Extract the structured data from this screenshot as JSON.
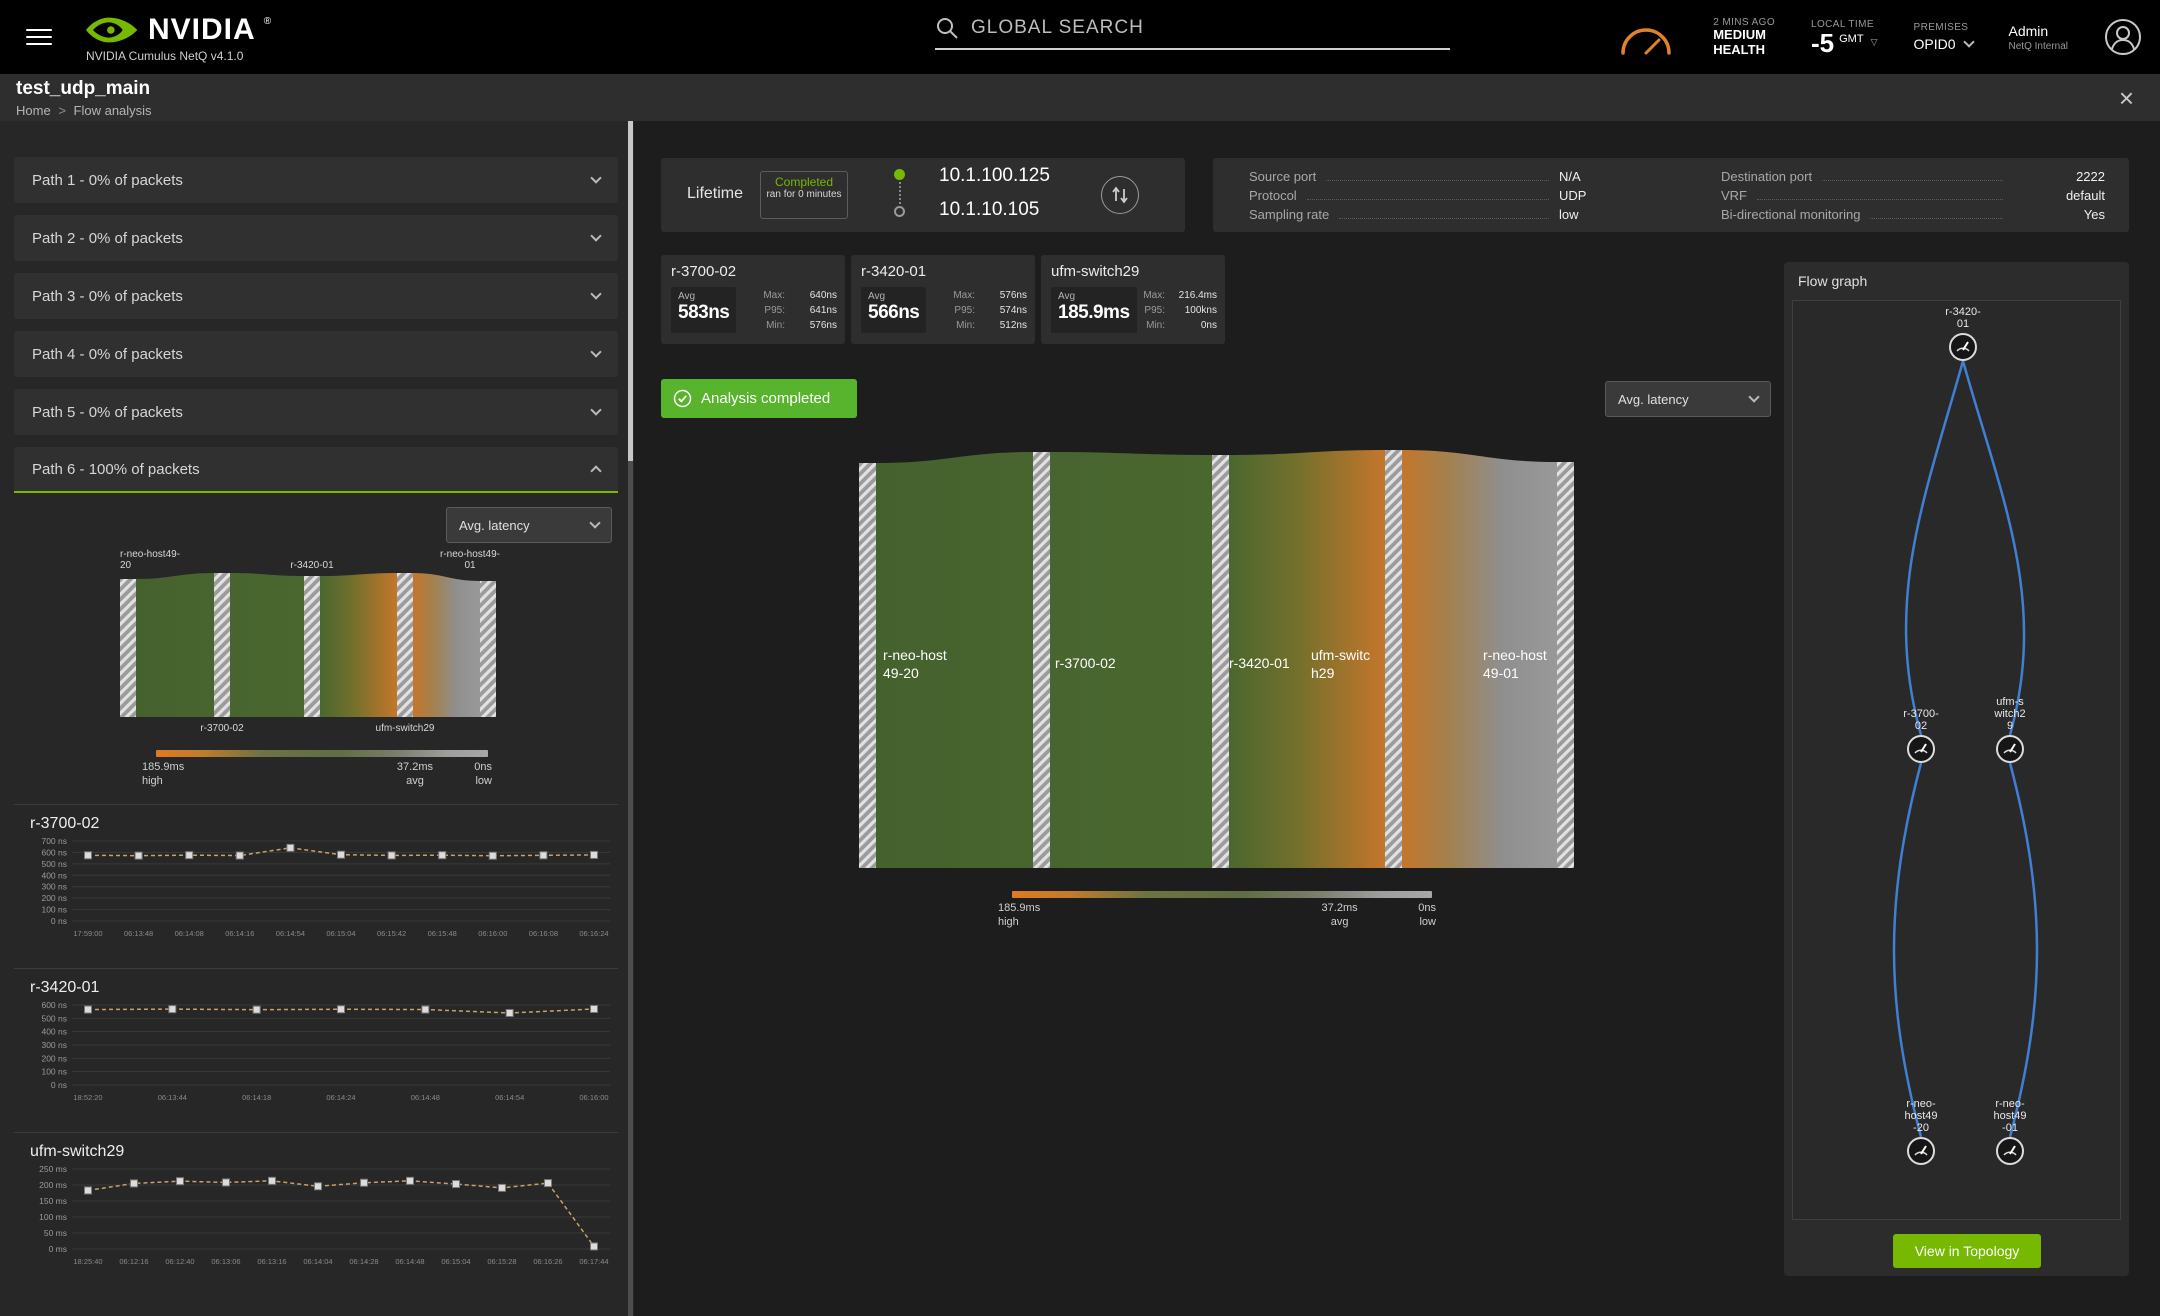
{
  "header": {
    "wordmark": "NVIDIA",
    "wordmark_reg": "®",
    "product": "NVIDIA Cumulus NetQ v4.1.0",
    "search_placeholder": "GLOBAL SEARCH",
    "health_ago": "2 MINS AGO",
    "health_line1": "MEDIUM",
    "health_line2": "HEALTH",
    "local_time_label": "LOCAL TIME",
    "local_time_offset": "-5",
    "local_time_zone": "GMT",
    "premises_label": "PREMISES",
    "premises_value": "OPID0",
    "user_name": "Admin",
    "user_org": "NetQ Internal"
  },
  "pagebar": {
    "title": "test_udp_main",
    "breadcrumb_home": "Home",
    "breadcrumb_sep": ">",
    "breadcrumb_current": "Flow analysis",
    "close": "×"
  },
  "paths": [
    {
      "label": "Path 1 - 0% of packets",
      "expanded": false
    },
    {
      "label": "Path 2 - 0% of packets",
      "expanded": false
    },
    {
      "label": "Path 3 - 0% of packets",
      "expanded": false
    },
    {
      "label": "Path 4 - 0% of packets",
      "expanded": false
    },
    {
      "label": "Path 5 - 0% of packets",
      "expanded": false
    },
    {
      "label": "Path 6 - 100% of packets",
      "expanded": true
    }
  ],
  "metric_dropdown": "Avg. latency",
  "legend": {
    "high_value": "185.9ms",
    "high_label": "high",
    "avg_value": "37.2ms",
    "avg_label": "avg",
    "low_value": "0ns",
    "low_label": "low"
  },
  "lifetime": {
    "label": "Lifetime",
    "status": "Completed",
    "status_detail": "ran for 0 minutes",
    "source_ip": "10.1.100.125",
    "dest_ip": "10.1.10.105"
  },
  "details": {
    "rows_left": [
      {
        "label": "Source port",
        "value": "N/A"
      },
      {
        "label": "Protocol",
        "value": "UDP"
      },
      {
        "label": "Sampling rate",
        "value": "low"
      }
    ],
    "rows_right": [
      {
        "label": "Destination port",
        "value": "2222"
      },
      {
        "label": "VRF",
        "value": "default"
      },
      {
        "label": "Bi-directional monitoring",
        "value": "Yes"
      }
    ]
  },
  "device_cards": [
    {
      "name": "r-3700-02",
      "avg_label": "Avg",
      "avg": "583ns",
      "stats": [
        {
          "k": "Max:",
          "v": "640ns"
        },
        {
          "k": "P95:",
          "v": "641ns"
        },
        {
          "k": "Min:",
          "v": "576ns"
        }
      ]
    },
    {
      "name": "r-3420-01",
      "avg_label": "Avg",
      "avg": "566ns",
      "stats": [
        {
          "k": "Max:",
          "v": "576ns"
        },
        {
          "k": "P95:",
          "v": "574ns"
        },
        {
          "k": "Min:",
          "v": "512ns"
        }
      ]
    },
    {
      "name": "ufm-switch29",
      "avg_label": "Avg",
      "avg": "185.9ms",
      "stats": [
        {
          "k": "Max:",
          "v": "216.4ms"
        },
        {
          "k": "P95:",
          "v": "100kns"
        },
        {
          "k": "Min:",
          "v": "0ns"
        }
      ]
    }
  ],
  "status_banner": "Analysis completed",
  "sankey": {
    "node_labels": [
      [
        "r-neo-host",
        "49-20"
      ],
      [
        "r-3700-02"
      ],
      [
        "r-3420-01"
      ],
      [
        "ufm-switc",
        "h29"
      ],
      [
        "r-neo-host",
        "49-01"
      ]
    ],
    "mini_top_labels": [
      [
        "r-neo-host49-",
        "20"
      ],
      [
        "r-3420-01"
      ],
      [
        "r-neo-host49-",
        "01"
      ]
    ],
    "mini_bottom_labels": [
      "r-3700-02",
      "ufm-switch29"
    ]
  },
  "chart_data": [
    {
      "type": "line",
      "title": "r-3700-02",
      "unit": "ns",
      "ylim": [
        0,
        700
      ],
      "y_step": 100,
      "x": [
        "17:59:00",
        "06:13:48",
        "06:14:08",
        "06:14:16",
        "06:14:54",
        "06:15:04",
        "06:15:42",
        "06:15:48",
        "06:16:00",
        "06:16:08",
        "06:16:24"
      ],
      "values": [
        575,
        572,
        576,
        573,
        640,
        580,
        574,
        576,
        571,
        575,
        578
      ]
    },
    {
      "type": "line",
      "title": "r-3420-01",
      "unit": "ns",
      "ylim": [
        0,
        600
      ],
      "y_step": 100,
      "x": [
        "18:52:20",
        "06:13:44",
        "06:14:18",
        "06:14:24",
        "06:14:48",
        "06:14:54",
        "06:16:00"
      ],
      "values": [
        566,
        569,
        565,
        568,
        566,
        540,
        570
      ]
    },
    {
      "type": "line",
      "title": "ufm-switch29",
      "unit": "ms",
      "ylim": [
        0,
        250
      ],
      "y_step": 50,
      "x": [
        "18:25:40",
        "06:12:16",
        "06:12:40",
        "06:13:06",
        "06:13:16",
        "06:14:04",
        "06:14:28",
        "06:14:48",
        "06:15:04",
        "06:15:28",
        "06:16:26",
        "06:17:44"
      ],
      "values": [
        183,
        205,
        212,
        208,
        213,
        196,
        207,
        213,
        203,
        191,
        206,
        8
      ]
    }
  ],
  "flow_graph": {
    "title": "Flow graph",
    "button": "View in Topology",
    "nodes": [
      {
        "id": "r-3420-01",
        "lines": [
          "r-3420-",
          "01"
        ]
      },
      {
        "id": "r-3700-02",
        "lines": [
          "r-3700-",
          "02"
        ]
      },
      {
        "id": "ufm-switch29",
        "lines": [
          "ufm-s",
          "witch2",
          "9"
        ]
      },
      {
        "id": "r-neo-host49-20",
        "lines": [
          "r-neo-",
          "host49",
          "-20"
        ]
      },
      {
        "id": "r-neo-host49-01",
        "lines": [
          "r-neo-",
          "host49",
          "-01"
        ]
      }
    ]
  },
  "colors": {
    "accent_green": "#76b900",
    "banner_green": "#58b32d",
    "flow_blue": "#3f7fd4",
    "latency_high_orange": "#e07a1f",
    "latency_low_gray": "#a8a8a8",
    "sankey_green": "#48652f",
    "sankey_orange": "#c4762b"
  }
}
